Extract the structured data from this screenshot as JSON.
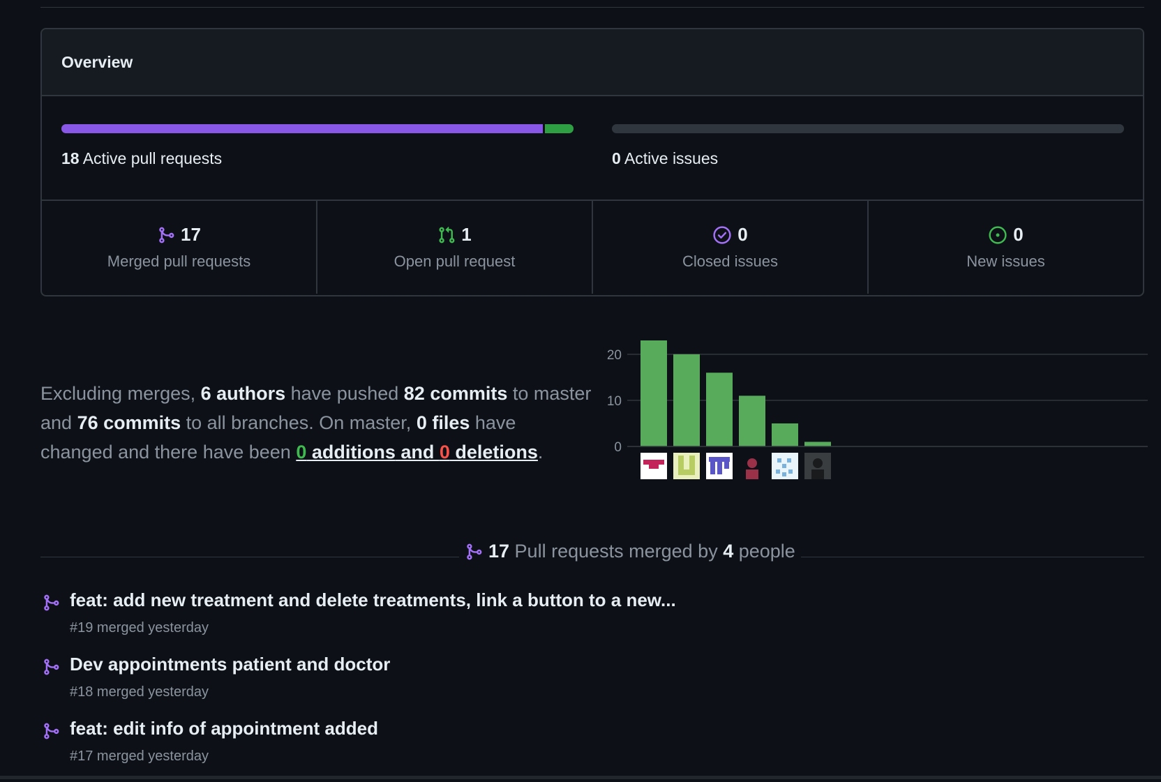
{
  "overview": {
    "title": "Overview",
    "pull_requests_bar": {
      "merged_fraction": 0.944,
      "open_fraction": 0.056,
      "count": "18",
      "label": "Active pull requests"
    },
    "issues_bar": {
      "count": "0",
      "label": "Active issues"
    },
    "stats": [
      {
        "icon": "git-merge-icon",
        "value": "17",
        "label": "Merged pull requests",
        "color": "#a371f7"
      },
      {
        "icon": "git-pull-request-icon",
        "value": "1",
        "label": "Open pull request",
        "color": "#3fb950"
      },
      {
        "icon": "issue-closed-icon",
        "value": "0",
        "label": "Closed issues",
        "color": "#a371f7"
      },
      {
        "icon": "issue-opened-icon",
        "value": "0",
        "label": "New issues",
        "color": "#3fb950"
      }
    ]
  },
  "summary": {
    "t1": "Excluding merges, ",
    "authors": "6 authors",
    "t2": " have pushed ",
    "commits_master": "82 commits",
    "t3": " to master and ",
    "commits_all": "76 commits",
    "t4": " to all branches. On master, ",
    "files": "0 files",
    "t5": " have changed and there have been ",
    "additions_num": "0",
    "additions_word": " additions",
    "t6": " and ",
    "deletions_num": "0",
    "deletions_word": " deletions",
    "t7": "."
  },
  "chart_data": {
    "type": "bar",
    "categories": [
      "author-1",
      "author-2",
      "author-3",
      "author-4",
      "author-5",
      "author-6"
    ],
    "values": [
      23,
      20,
      16,
      11,
      5,
      1
    ],
    "yticks": [
      0,
      10,
      20
    ],
    "ylim": [
      0,
      23
    ],
    "grid": true,
    "bar_color": "#57ab5a",
    "avatars": [
      {
        "bg": "#ffffff",
        "fg": "#c3245a",
        "pattern": "bar"
      },
      {
        "bg": "#e9efbd",
        "fg": "#b7cc62",
        "pattern": "blocks"
      },
      {
        "bg": "#ffffff",
        "fg": "#5b56c7",
        "pattern": "grid"
      },
      {
        "bg": "#0d1117",
        "fg": "#9b3049",
        "pattern": "photo"
      },
      {
        "bg": "#e9f4fb",
        "fg": "#79b2dc",
        "pattern": "dots"
      },
      {
        "bg": "#3a3d40",
        "fg": "#1a1b1c",
        "pattern": "photo"
      }
    ]
  },
  "merged_heading": {
    "count": "17",
    "text1": " Pull requests merged by ",
    "people": "4",
    "text2": " people"
  },
  "pull_requests": [
    {
      "title": "feat: add new treatment and delete treatments, link a button to a new...",
      "meta": "#19 merged yesterday"
    },
    {
      "title": "Dev appointments patient and doctor",
      "meta": "#18 merged yesterday"
    },
    {
      "title": "feat: edit info of appointment added",
      "meta": "#17 merged yesterday"
    }
  ],
  "colors": {
    "merged": "#8957e5",
    "open": "#2ea043",
    "background": "#0d1117",
    "border": "#30363d"
  }
}
